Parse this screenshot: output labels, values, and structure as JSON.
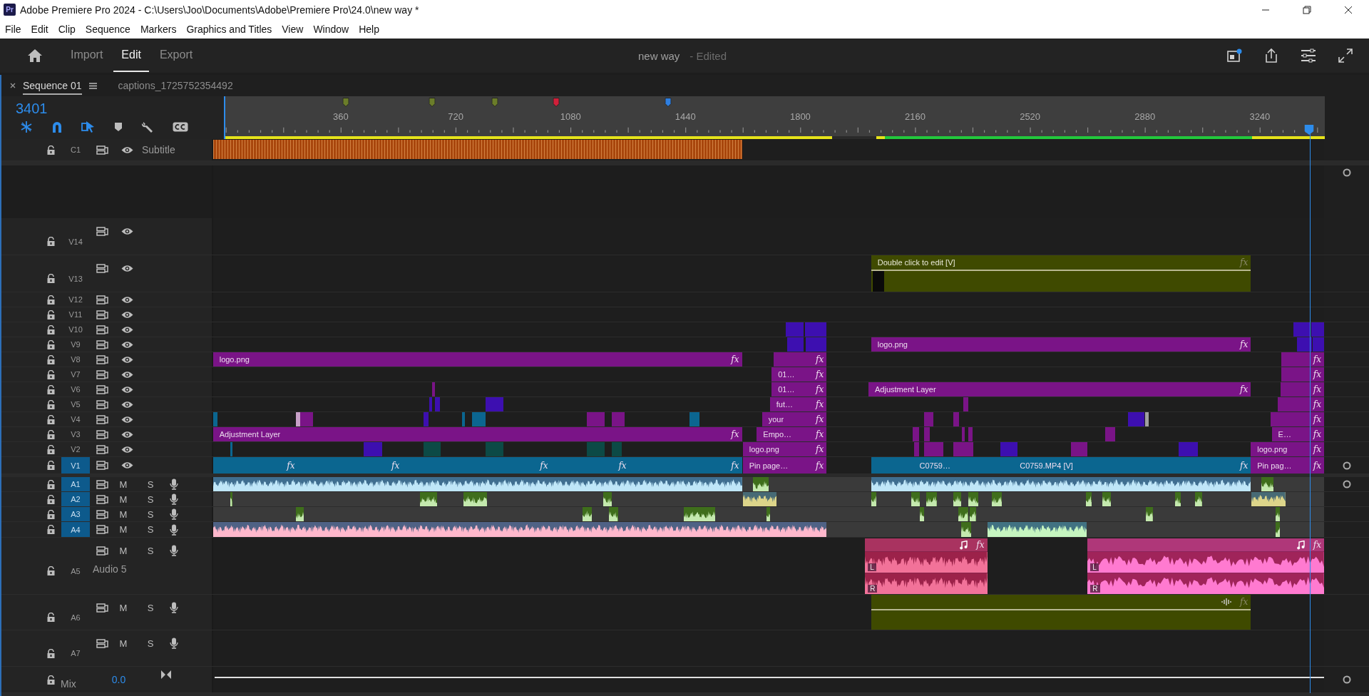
{
  "titlebar": {
    "app_icon": "Pr",
    "title": "Adobe Premiere Pro 2024 - C:\\Users\\Joo\\Documents\\Adobe\\Premiere Pro\\24.0\\new way *"
  },
  "menu": [
    "File",
    "Edit",
    "Clip",
    "Sequence",
    "Markers",
    "Graphics and Titles",
    "View",
    "Window",
    "Help"
  ],
  "workspace_tabs": [
    {
      "label": "Import",
      "selected": false
    },
    {
      "label": "Edit",
      "selected": true
    },
    {
      "label": "Export",
      "selected": false
    }
  ],
  "document": {
    "name": "new way",
    "status": "- Edited"
  },
  "panel_tabs": [
    {
      "label": "Sequence 01",
      "selected": true,
      "closable": true,
      "menu": true
    },
    {
      "label": "captions_1725752354492",
      "selected": false
    }
  ],
  "timecode": "3401",
  "tools": [
    {
      "kind": "snap",
      "on": true
    },
    {
      "kind": "link",
      "on": true
    },
    {
      "kind": "select",
      "on": true
    },
    {
      "kind": "marker",
      "on": false
    },
    {
      "kind": "wrench",
      "on": false
    },
    {
      "kind": "captions",
      "on": false
    }
  ],
  "ruler": {
    "labels": [
      "360",
      "720",
      "1080",
      "1440",
      "1800",
      "2160",
      "2520",
      "2880",
      "3240"
    ]
  },
  "markers": [
    {
      "color": "#6b7d2a"
    },
    {
      "color": "#6b7d2a"
    },
    {
      "color": "#6b7d2a"
    },
    {
      "color": "#d0203a"
    },
    {
      "color": "#2f7fe0"
    }
  ],
  "tracks": [
    {
      "name": "C1",
      "kind": "caption",
      "title": "Subtitle",
      "targeted": false,
      "clips": [
        {
          "color": "#a8460c"
        }
      ]
    },
    {
      "name": "V14",
      "kind": "video",
      "targeted": false
    },
    {
      "name": "V13",
      "kind": "video",
      "targeted": false,
      "clips": [
        {
          "kind": "title",
          "color": "#3f4a00",
          "label": "Double click to edit [V]",
          "fx": "fx"
        }
      ]
    },
    {
      "name": "V12",
      "kind": "video",
      "targeted": false
    },
    {
      "name": "V11",
      "kind": "video",
      "targeted": false
    },
    {
      "name": "V10",
      "kind": "video",
      "targeted": false,
      "clips": [
        {
          "color": "#3d0fb0"
        },
        {
          "color": "#3d0fb0"
        },
        {
          "color": "#3d0fb0"
        },
        {
          "color": "#3d0fb0"
        }
      ]
    },
    {
      "name": "V9",
      "kind": "video",
      "targeted": false,
      "clips": [
        {
          "color": "#3d0fb0"
        },
        {
          "color": "#3d0fb0"
        },
        {
          "color": "#7a1487",
          "label": "logo.png",
          "fx": "fx"
        },
        {
          "color": "#3d0fb0"
        },
        {
          "color": "#3d0fb0"
        }
      ]
    },
    {
      "name": "V8",
      "kind": "video",
      "targeted": false,
      "clips": [
        {
          "color": "#7a1487",
          "label": "logo.png",
          "fx": "fx"
        },
        {
          "color": "#7a1487",
          "fx": "fx"
        },
        {
          "color": "#7a1487",
          "fx": "fx"
        }
      ]
    },
    {
      "name": "V7",
      "kind": "video",
      "targeted": false,
      "clips": [
        {
          "color": "#7a1487",
          "label": "01…",
          "fx": "fx"
        },
        {
          "color": "#7a1487",
          "fx": "fx"
        }
      ]
    },
    {
      "name": "V6",
      "kind": "video",
      "targeted": false,
      "clips": [
        {
          "color": "#7a1487"
        },
        {
          "color": "#7a1487",
          "label": "01…",
          "fx": "fx"
        },
        {
          "color": "#7a1487",
          "label": "Adjustment Layer",
          "fx": "fx"
        },
        {
          "color": "#7a1487",
          "fx": "fx"
        }
      ]
    },
    {
      "name": "V5",
      "kind": "video",
      "targeted": false,
      "clips": [
        {
          "color": "#3d0fb0"
        },
        {
          "color": "#3d0fb0"
        },
        {
          "color": "#3d0fb0"
        },
        {
          "color": "#7a1487",
          "label": "fut…",
          "fx": "fx"
        },
        {
          "color": "#7a1487"
        },
        {
          "color": "#7a1487",
          "fx": "fx"
        }
      ]
    },
    {
      "name": "V4",
      "kind": "video",
      "targeted": false,
      "clips": [
        {
          "color": "#0b6690"
        },
        {
          "color": "#c8a0c8"
        },
        {
          "color": "#7a1487"
        },
        {
          "color": "#3d0fb0"
        },
        {
          "color": "#0b6690"
        },
        {
          "color": "#0b6690"
        },
        {
          "color": "#7a1487"
        },
        {
          "color": "#7a1487"
        },
        {
          "color": "#0b6690"
        },
        {
          "color": "#7a1487",
          "label": "your",
          "fx": "fx"
        },
        {
          "color": "#7a1487"
        },
        {
          "color": "#7a1487"
        },
        {
          "color": "#3d0fb0"
        },
        {
          "color": "#a0a0a0"
        },
        {
          "color": "#7a1487",
          "fx": "fx"
        }
      ]
    },
    {
      "name": "V3",
      "kind": "video",
      "targeted": false,
      "clips": [
        {
          "color": "#7a1487",
          "label": "Adjustment Layer",
          "fx": "fx"
        },
        {
          "color": "#7a1487",
          "label": "Empo…",
          "fx": "fx"
        },
        {
          "color": "#7a1487"
        },
        {
          "color": "#7a1487"
        },
        {
          "color": "#7a1487"
        },
        {
          "color": "#7a1487"
        },
        {
          "color": "#7a1487"
        },
        {
          "color": "#7a1487",
          "label": "E…",
          "fx": "fx"
        }
      ]
    },
    {
      "name": "V2",
      "kind": "video",
      "targeted": false,
      "clips": [
        {
          "color": "#0b6690"
        },
        {
          "color": "#3d0fb0"
        },
        {
          "color": "#0c4a46"
        },
        {
          "color": "#0c4a46"
        },
        {
          "color": "#0c4a46"
        },
        {
          "color": "#0c4a46"
        },
        {
          "color": "#7a1487",
          "label": "logo.png",
          "fx": "fx"
        },
        {
          "color": "#7a1487"
        },
        {
          "color": "#7a1487"
        },
        {
          "color": "#7a1487"
        },
        {
          "color": "#3d0fb0"
        },
        {
          "color": "#7a1487"
        },
        {
          "color": "#3d0fb0"
        },
        {
          "color": "#7a1487",
          "label": "logo.png",
          "fx": "fx"
        }
      ]
    },
    {
      "name": "V1",
      "kind": "video",
      "targeted": true,
      "clips": [
        {
          "color": "#0b6690",
          "fx": "fx"
        },
        {
          "color": "#0b6690",
          "fx": "fx"
        },
        {
          "color": "#0b6690",
          "fx": "fx"
        },
        {
          "color": "#0b6690",
          "fx": "fx"
        },
        {
          "color": "#0b6690",
          "fx": "fx"
        },
        {
          "color": "#7a1487",
          "label": "Pin page…",
          "fx": "fx"
        },
        {
          "color": "#0b6690"
        },
        {
          "color": "#0b6690",
          "label": "C0759…"
        },
        {
          "color": "#0b6690"
        },
        {
          "color": "#0b6690",
          "label": "C0759.MP4 [V]",
          "fx": "fx"
        },
        {
          "color": "#7a1487",
          "label": "Pin pag…",
          "fx": "fx"
        }
      ]
    },
    {
      "name": "A1",
      "kind": "audio",
      "targeted": true,
      "mute": "M",
      "solo": "S",
      "clips": [
        {
          "color": "#bfe6f8"
        },
        {
          "color": "#3f6e1c"
        },
        {
          "color": "#bfe6f8"
        },
        {
          "color": "#3f6e1c"
        }
      ]
    },
    {
      "name": "A2",
      "kind": "audio",
      "targeted": true,
      "mute": "M",
      "solo": "S",
      "clips": [
        {
          "color": "#3f6e1c"
        },
        {
          "color": "#3f6e1c"
        },
        {
          "color": "#3f6e1c"
        },
        {
          "color": "#3f6e1c"
        },
        {
          "color": "#ddd58a"
        },
        {
          "color": "#3f6e1c"
        },
        {
          "color": "#3f6e1c"
        },
        {
          "color": "#3f6e1c"
        },
        {
          "color": "#3f6e1c"
        },
        {
          "color": "#3f6e1c"
        },
        {
          "color": "#3f6e1c"
        },
        {
          "color": "#3f6e1c"
        },
        {
          "color": "#3f6e1c"
        },
        {
          "color": "#3f6e1c"
        },
        {
          "color": "#3f6e1c"
        },
        {
          "color": "#ddd58a"
        }
      ]
    },
    {
      "name": "A3",
      "kind": "audio",
      "targeted": true,
      "mute": "M",
      "solo": "S",
      "clips": [
        {
          "color": "#3f6e1c"
        },
        {
          "color": "#3f6e1c"
        },
        {
          "color": "#3f6e1c"
        },
        {
          "color": "#3f6e1c"
        },
        {
          "color": "#3f6e1c"
        },
        {
          "color": "#3f6e1c"
        },
        {
          "color": "#3f6e1c"
        },
        {
          "color": "#3f6e1c"
        },
        {
          "color": "#3f6e1c"
        },
        {
          "color": "#3f6e1c"
        }
      ]
    },
    {
      "name": "A4",
      "kind": "audio",
      "targeted": true,
      "mute": "M",
      "solo": "S",
      "clips": [
        {
          "color": "#ffb8cc"
        },
        {
          "color": "#3f6e1c"
        },
        {
          "color": "#c6f5c0"
        },
        {
          "color": "#3f6e1c"
        }
      ]
    },
    {
      "name": "A5",
      "kind": "audio",
      "title": "Audio 5",
      "targeted": false,
      "mute": "M",
      "solo": "S",
      "clips": [
        {
          "kind": "stereo",
          "color": "#f27299",
          "fx": "fx",
          "channels": [
            "L",
            "R"
          ]
        },
        {
          "kind": "stereo",
          "color": "#ff7ad0",
          "fx": "fx",
          "channels": [
            "L",
            "R"
          ]
        }
      ]
    },
    {
      "name": "A6",
      "kind": "audio",
      "targeted": false,
      "mute": "M",
      "solo": "S",
      "clips": [
        {
          "kind": "audio_title",
          "color": "#3f4a00",
          "fx": "fx"
        }
      ]
    },
    {
      "name": "A7",
      "kind": "audio",
      "targeted": false,
      "mute": "M",
      "solo": "S"
    }
  ],
  "mix": {
    "label": "Mix",
    "value": "0.0"
  }
}
